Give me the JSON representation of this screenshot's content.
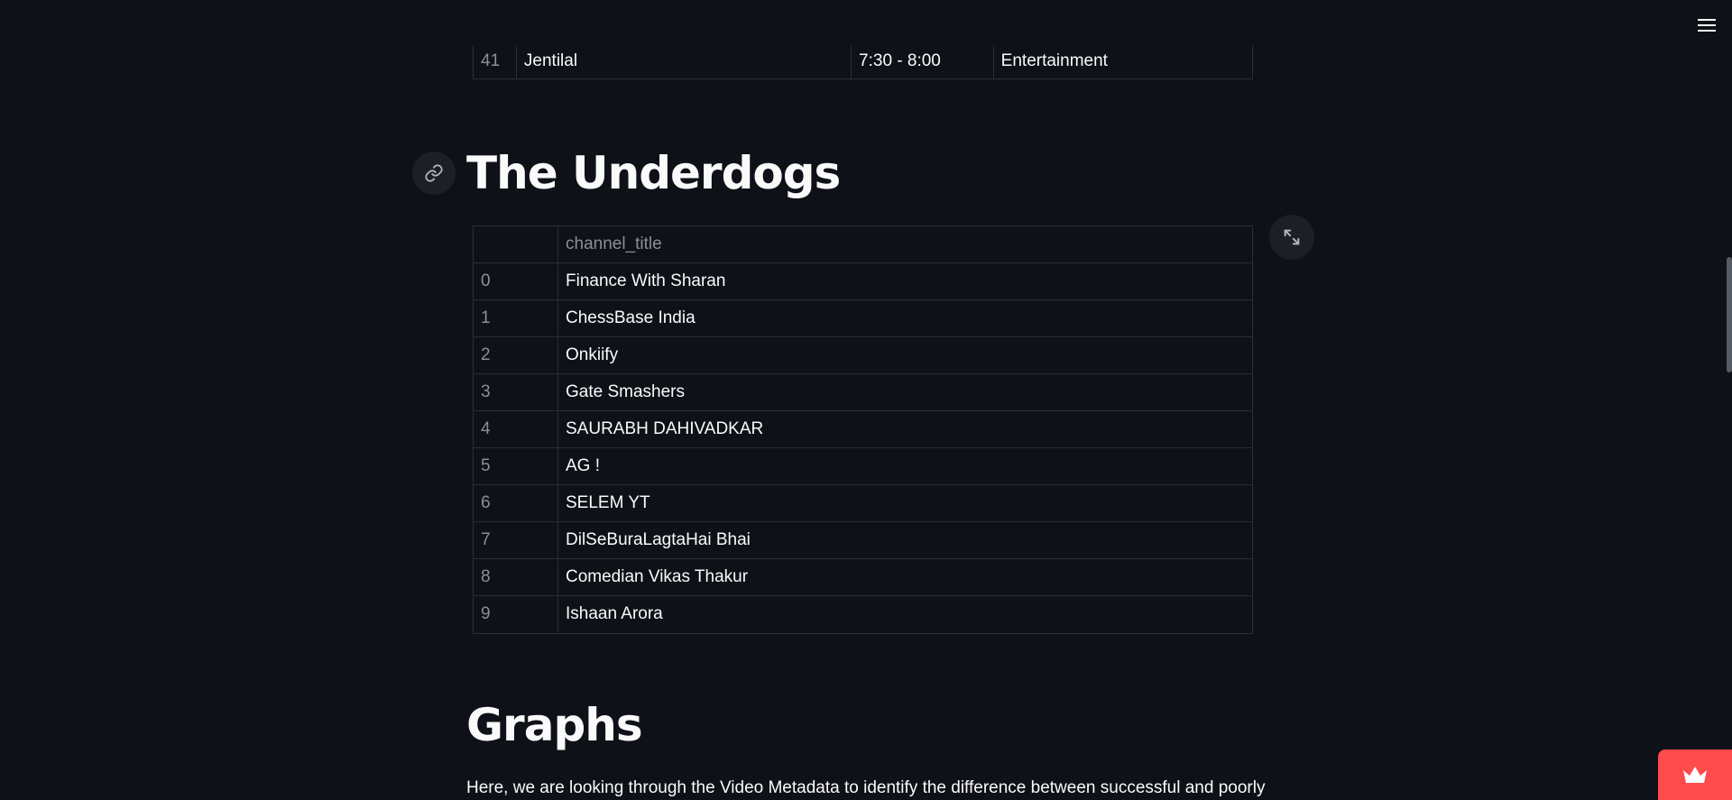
{
  "prev_table": {
    "index": "41",
    "col1": "Jentilal",
    "col2": "7:30 - 8:00",
    "col3": "Entertainment"
  },
  "headings": {
    "underdogs": "The Underdogs",
    "graphs": "Graphs"
  },
  "dataframe": {
    "column": "channel_title",
    "rows": [
      {
        "idx": "0",
        "value": "Finance With Sharan"
      },
      {
        "idx": "1",
        "value": "ChessBase India"
      },
      {
        "idx": "2",
        "value": "Onkiify"
      },
      {
        "idx": "3",
        "value": "Gate Smashers"
      },
      {
        "idx": "4",
        "value": "SAURABH DAHIVADKAR"
      },
      {
        "idx": "5",
        "value": "AG !"
      },
      {
        "idx": "6",
        "value": "SELEM YT"
      },
      {
        "idx": "7",
        "value": "DilSeBuraLagtaHai Bhai"
      },
      {
        "idx": "8",
        "value": "Comedian Vikas Thakur"
      },
      {
        "idx": "9",
        "value": "Ishaan Arora"
      }
    ]
  },
  "paragraph": "Here, we are looking through the Video Metadata to identify the difference between successful and poorly",
  "icons": {
    "menu": "hamburger-menu-icon",
    "link": "link-icon",
    "expand": "fullscreen-expand-icon",
    "badge": "crown-icon"
  },
  "colors": {
    "background": "#0e1117",
    "text": "#fafafa",
    "muted": "#8b8f97",
    "border": "#2a2e37",
    "badge": "#ff4b4b"
  }
}
